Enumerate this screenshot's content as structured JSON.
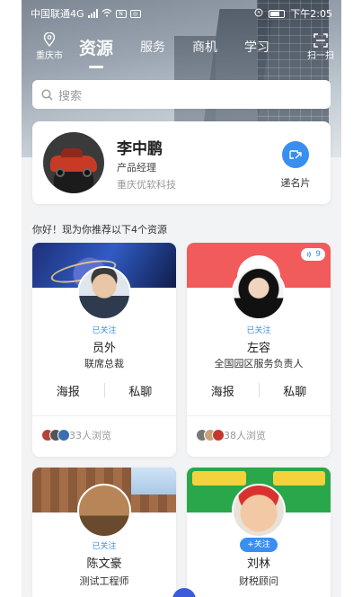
{
  "status_bar": {
    "carrier": "中国联通4G",
    "network_tag": "4G",
    "time": "下午2:05"
  },
  "nav": {
    "city": "重庆市",
    "tabs": [
      {
        "label": "资源",
        "active": true
      },
      {
        "label": "服务",
        "active": false
      },
      {
        "label": "商机",
        "active": false
      },
      {
        "label": "学习",
        "active": false
      }
    ],
    "scan_label": "扫一扫"
  },
  "search": {
    "placeholder": "搜索"
  },
  "profile": {
    "name": "李中鹏",
    "title": "产品经理",
    "company": "重庆优软科技",
    "send_card_label": "递名片"
  },
  "recommend_text": "你好！现为你推荐以下4个资源",
  "cards": [
    {
      "banner_text": "",
      "tag": "已关注",
      "name": "员外",
      "role": "联席总裁",
      "poster": "海报",
      "chat": "私聊",
      "views": "33人浏览"
    },
    {
      "badge": "9",
      "tag": "已关注",
      "name": "左容",
      "role": "全国园区服务负责人",
      "poster": "海报",
      "chat": "私聊",
      "views": "38人浏览"
    },
    {
      "tag": "已关注",
      "name": "陈文豪",
      "role": "测试工程师"
    },
    {
      "tag": "+关注",
      "name": "刘林",
      "role": "财税顾问"
    }
  ],
  "colors": {
    "accent": "#3a8ef0",
    "fab": "#3b5bdb"
  }
}
